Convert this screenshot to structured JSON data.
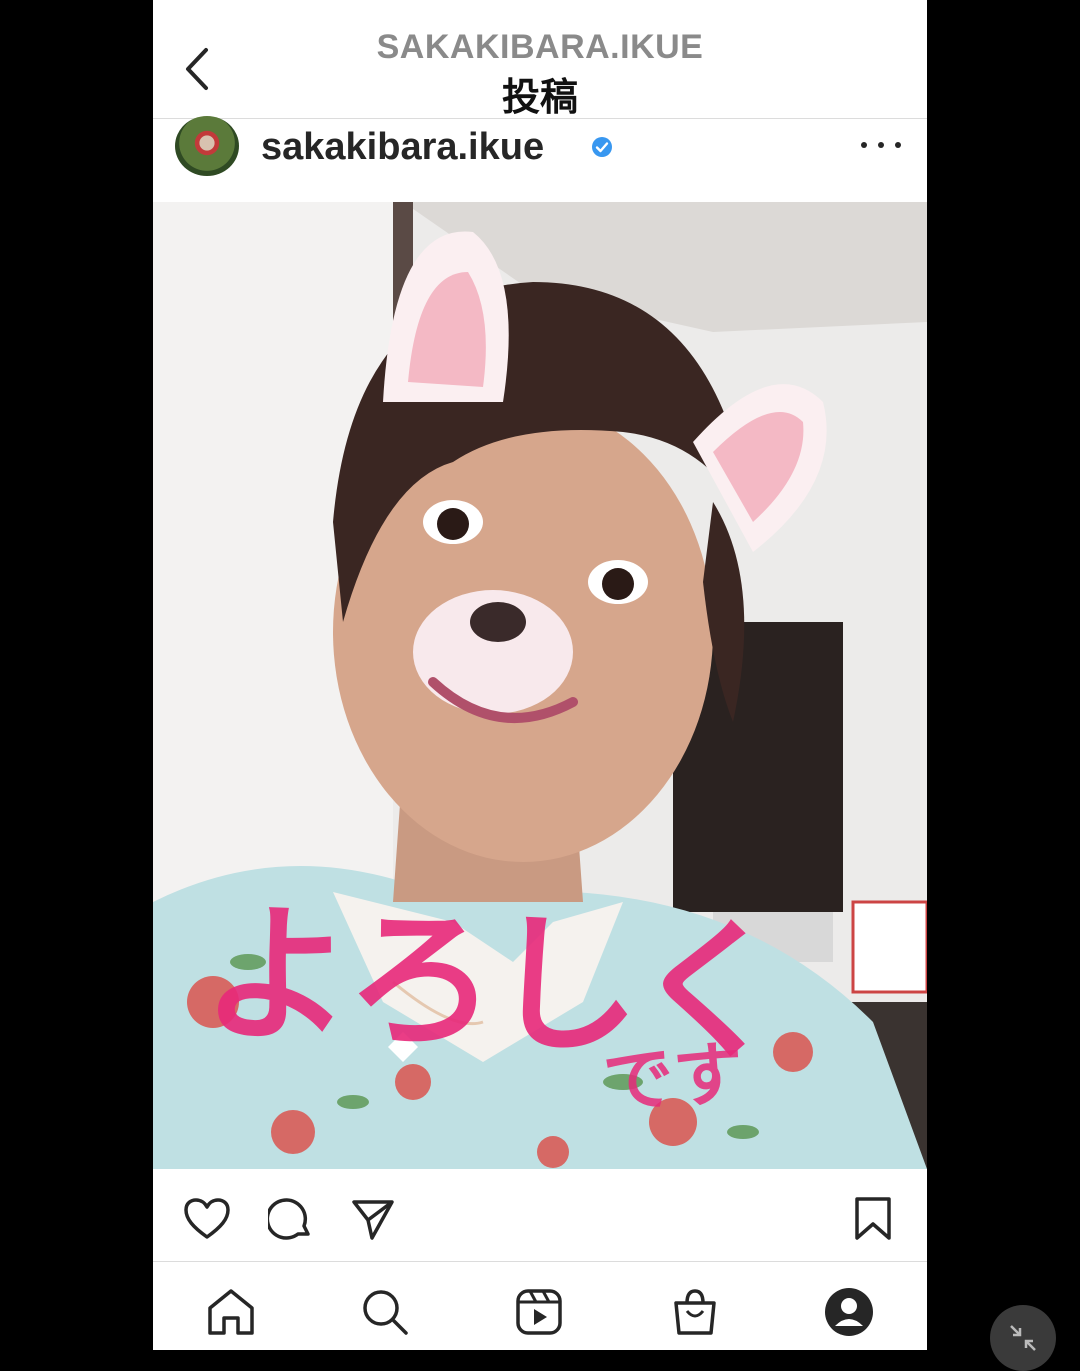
{
  "header": {
    "username": "SAKAKIBARA.IKUE",
    "title": "投稿",
    "back_icon": "chevron-left-icon"
  },
  "post": {
    "owner_name": "sakakibara.ikue",
    "verified": true,
    "image_overlay_text": "よろしく",
    "image_overlay_text_small": "です"
  },
  "colors": {
    "verified_blue": "#3897f0",
    "overlay_pink": "#e8297a",
    "text_dark": "#262626"
  },
  "actions": {
    "icons": [
      "heart-icon",
      "comment-icon",
      "share-icon",
      "bookmark-icon"
    ]
  },
  "nav": {
    "icons": [
      "home-icon",
      "search-icon",
      "reels-icon",
      "shop-icon",
      "profile-icon"
    ]
  }
}
